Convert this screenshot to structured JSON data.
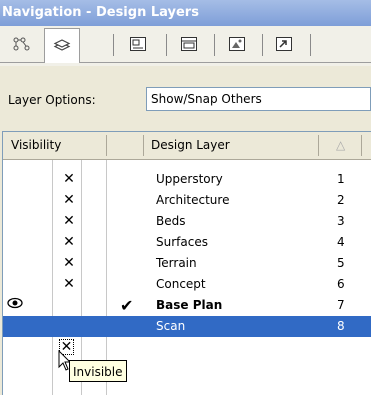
{
  "window": {
    "title": "Navigation - Design Layers"
  },
  "tabs": [
    {
      "icon": "class-tree-icon"
    },
    {
      "icon": "layers-icon",
      "active": true
    },
    {
      "icon": "sheet-layers-icon"
    },
    {
      "icon": "viewports-icon"
    },
    {
      "icon": "saved-views-icon"
    },
    {
      "icon": "references-icon"
    }
  ],
  "layer_options": {
    "label": "Layer Options:",
    "value": "Show/Snap Others"
  },
  "table": {
    "headers": {
      "visibility": "Visibility",
      "design_layer": "Design Layer",
      "sort": "△"
    },
    "rows": [
      {
        "visibility": "✕",
        "active": "",
        "name": "Upperstory",
        "num": "1"
      },
      {
        "visibility": "✕",
        "active": "",
        "name": "Architecture",
        "num": "2"
      },
      {
        "visibility": "✕",
        "active": "",
        "name": "Beds",
        "num": "3"
      },
      {
        "visibility": "✕",
        "active": "",
        "name": "Surfaces",
        "num": "4"
      },
      {
        "visibility": "✕",
        "active": "",
        "name": "Terrain",
        "num": "5"
      },
      {
        "visibility": "✕",
        "active": "",
        "name": "Concept",
        "num": "6"
      },
      {
        "visibility": "eye",
        "active": "✔",
        "name": "Base Plan",
        "num": "7",
        "bold": true
      },
      {
        "visibility": "✕",
        "active": "",
        "name": "Scan",
        "num": "8",
        "selected": true
      }
    ]
  },
  "tooltip": {
    "text": "Invisible"
  },
  "colors": {
    "selection": "#316ac5",
    "title_bar": "#7e9ed8"
  }
}
